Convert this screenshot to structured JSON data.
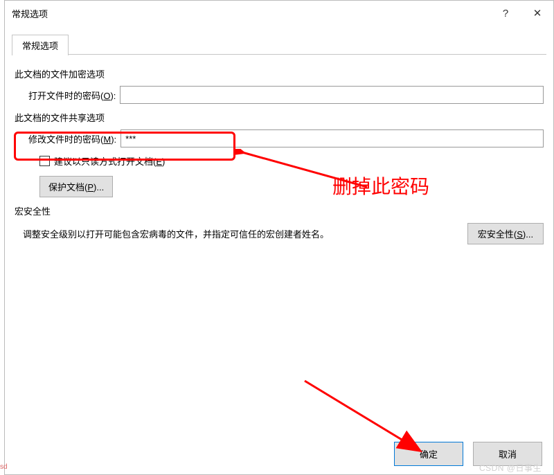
{
  "window": {
    "title": "常规选项",
    "help_icon": "?",
    "close_icon": "✕"
  },
  "tabs": {
    "active": "常规选项"
  },
  "sections": {
    "encrypt": {
      "label": "此文档的文件加密选项",
      "open_password_label_pre": "打开文件时的密码(",
      "open_password_label_key": "O",
      "open_password_label_post": "):",
      "open_password_value": ""
    },
    "share": {
      "label": "此文档的文件共享选项",
      "modify_password_label_pre": "修改文件时的密码(",
      "modify_password_label_key": "M",
      "modify_password_label_post": "):",
      "modify_password_value": "***",
      "readonly_checkbox_pre": "建议以只读方式打开文档(",
      "readonly_checkbox_key": "E",
      "readonly_checkbox_post": ")",
      "protect_doc_label_pre": "保护文档(",
      "protect_doc_label_key": "P",
      "protect_doc_label_post": ")..."
    },
    "macro": {
      "label": "宏安全性",
      "desc": "调整安全级别以打开可能包含宏病毒的文件，并指定可信任的宏创建者姓名。",
      "macro_btn_pre": "宏安全性(",
      "macro_btn_key": "S",
      "macro_btn_post": ")..."
    }
  },
  "footer": {
    "ok": "确定",
    "cancel": "取消"
  },
  "annotations": {
    "delete_pwd": "删掉此密码",
    "watermark": "CSDN @日事生",
    "sd": "sd"
  },
  "colors": {
    "highlight": "#ff0000",
    "focus_border": "#0078d7"
  }
}
